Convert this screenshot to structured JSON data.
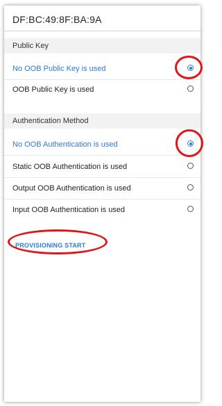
{
  "device": {
    "title": "DF:BC:49:8F:BA:9A"
  },
  "public_key": {
    "header": "Public Key",
    "options": [
      {
        "label": "No OOB Public Key is used",
        "selected": true
      },
      {
        "label": "OOB Public Key is used",
        "selected": false
      }
    ]
  },
  "auth_method": {
    "header": "Authentication Method",
    "options": [
      {
        "label": "No OOB Authentication is used",
        "selected": true
      },
      {
        "label": "Static OOB Authentication is used",
        "selected": false
      },
      {
        "label": "Output OOB Authentication is used",
        "selected": false
      },
      {
        "label": "Input OOB Authentication is used",
        "selected": false
      }
    ]
  },
  "actions": {
    "start_label": "PROVISIONING START"
  },
  "colors": {
    "accent": "#2a7bd8",
    "annotation": "#e01515",
    "section_bg": "#f2f2f2"
  }
}
